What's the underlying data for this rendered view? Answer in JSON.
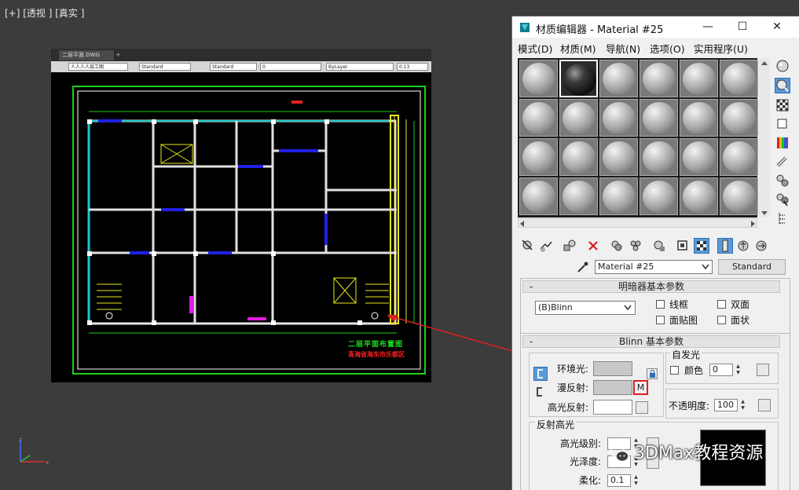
{
  "viewport": {
    "label": "[+] [透视 ] [真实 ]"
  },
  "cad": {
    "tab_label": "二层平面.DWG",
    "tab_plus": "+",
    "fields": [
      "人人人人层工图",
      "Standard",
      "Standard",
      "0",
      "ByLayer",
      "0.13"
    ],
    "drawing_title": "二层平面布置图",
    "drawing_subtitle": "青海省海东市乐都区"
  },
  "editor": {
    "title": "材质编辑器 - Material #25",
    "window_buttons": {
      "minimize": "—",
      "maximize": "☐",
      "close": "✕"
    },
    "menu": [
      "模式(D)",
      "材质(M)",
      "导航(N)",
      "选项(O)",
      "实用程序(U)"
    ],
    "material_name": "Material #25",
    "material_type": "Standard",
    "shader_rollout": {
      "title": "明暗器基本参数",
      "shader": "(B)Blinn",
      "options": [
        "线框",
        "双面",
        "面贴图",
        "面状"
      ]
    },
    "blinn_rollout": {
      "title": "Blinn 基本参数",
      "ambient_label": "环境光:",
      "diffuse_label": "漫反射:",
      "specular_label": "高光反射:",
      "map_button": "M",
      "self_illum_title": "自发光",
      "color_label": "颜色",
      "color_value": "0",
      "opacity_label": "不透明度:",
      "opacity_value": "100",
      "highlights_title": "反射高光",
      "spec_level_label": "高光级别:",
      "gloss_label": "光泽度:",
      "soften_label": "柔化:",
      "soften_value": "0.1"
    },
    "colors": {
      "ambient": "#c8c8c8",
      "diffuse": "#c8c8c8",
      "specular": "#ffffff",
      "accent_blue": "#5b9ad6",
      "annotation_red": "#e02020"
    }
  },
  "watermark": {
    "text": "3DMax教程资源",
    "icon": "wechat-icon"
  }
}
